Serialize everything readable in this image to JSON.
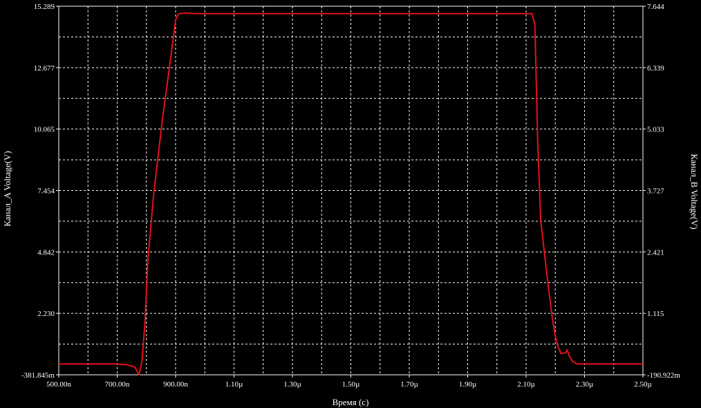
{
  "chart_data": {
    "type": "line",
    "xlabel": "Время (с)",
    "ylabel_left": "Канал_A Voltage(V)",
    "ylabel_right": "Канал_B Voltage(V)",
    "x_range_s": [
      5e-07,
      2.5e-06
    ],
    "x_ticks": [
      {
        "label": "500.00n",
        "value": 5e-07
      },
      {
        "label": "700.00n",
        "value": 7e-07
      },
      {
        "label": "900.00n",
        "value": 9e-07
      },
      {
        "label": "1.10µ",
        "value": 1.1e-06
      },
      {
        "label": "1.30µ",
        "value": 1.3e-06
      },
      {
        "label": "1.50µ",
        "value": 1.5e-06
      },
      {
        "label": "1.70µ",
        "value": 1.7e-06
      },
      {
        "label": "1.90µ",
        "value": 1.9e-06
      },
      {
        "label": "2.10µ",
        "value": 2.1e-06
      },
      {
        "label": "2.30µ",
        "value": 2.3e-06
      },
      {
        "label": "2.50µ",
        "value": 2.5e-06
      }
    ],
    "y_left_range": [
      -0.381845,
      15.289
    ],
    "y_left_ticks": [
      {
        "label": "15.289",
        "value": 15.289
      },
      {
        "label": "12.677",
        "value": 12.677
      },
      {
        "label": "10.065",
        "value": 10.065
      },
      {
        "label": "7.454",
        "value": 7.454
      },
      {
        "label": "4.842",
        "value": 4.842
      },
      {
        "label": "2.230",
        "value": 2.23
      },
      {
        "label": "-381.845m",
        "value": -0.381845
      }
    ],
    "y_right_range": [
      -0.190922,
      7.644
    ],
    "y_right_ticks": [
      {
        "label": "7.644",
        "value": 7.644
      },
      {
        "label": "6.339",
        "value": 6.339
      },
      {
        "label": "5.033",
        "value": 5.033
      },
      {
        "label": "3.727",
        "value": 3.727
      },
      {
        "label": "2.421",
        "value": 2.421
      },
      {
        "label": "1.115",
        "value": 1.115
      },
      {
        "label": "-190.922m",
        "value": -0.190922
      }
    ],
    "grid": true,
    "series": [
      {
        "color": "#e8101c",
        "x": [
          5e-07,
          6.9e-07,
          7.3e-07,
          7.6e-07,
          7.75e-07,
          7.85e-07,
          7.95e-07,
          8.05e-07,
          8.25e-07,
          8.55e-07,
          8.8e-07,
          9e-07,
          9.1e-07,
          9.3e-07,
          9.6e-07,
          1e-06,
          1.5e-06,
          2e-06,
          2.12e-06,
          2.13e-06,
          2.14e-06,
          2.15e-06,
          2.17e-06,
          2.19e-06,
          2.2e-06,
          2.21e-06,
          2.22e-06,
          2.235e-06,
          2.24e-06,
          2.25e-06,
          2.26e-06,
          2.275e-06,
          2.3e-06,
          2.5e-06
        ],
        "y": [
          0.08,
          0.08,
          0.05,
          -0.05,
          -0.38,
          0.2,
          1.8,
          4.5,
          7.3,
          10.5,
          12.8,
          14.7,
          14.96,
          15.0,
          14.98,
          14.97,
          14.97,
          14.97,
          14.97,
          14.5,
          9.4,
          6.2,
          4.0,
          2.0,
          1.25,
          0.78,
          0.52,
          0.55,
          0.68,
          0.36,
          0.18,
          0.08,
          0.08,
          0.08
        ]
      }
    ]
  }
}
